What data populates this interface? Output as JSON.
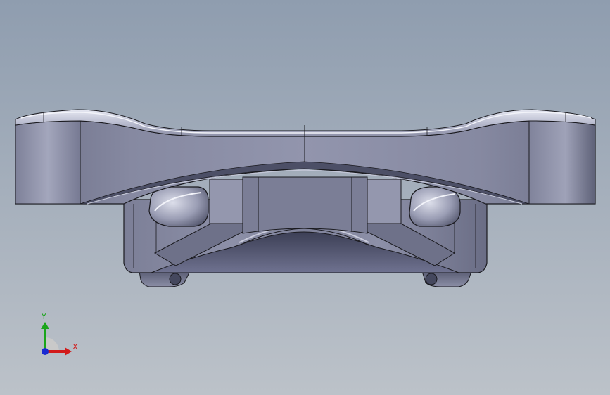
{
  "viewport": {
    "background_top": "#8f9daf",
    "background_bottom": "#bcc2c9"
  },
  "model": {
    "name": "3d-bracket-part",
    "view": "front",
    "face_color": "#8a8ea8",
    "edge_color": "#1a1a1f",
    "highlight_color": "#d5d7e6"
  },
  "triad": {
    "x_label": "X",
    "y_label": "Y",
    "x_color": "#d21a1a",
    "y_color": "#1aa51a",
    "z_color": "#1a2ad2"
  }
}
